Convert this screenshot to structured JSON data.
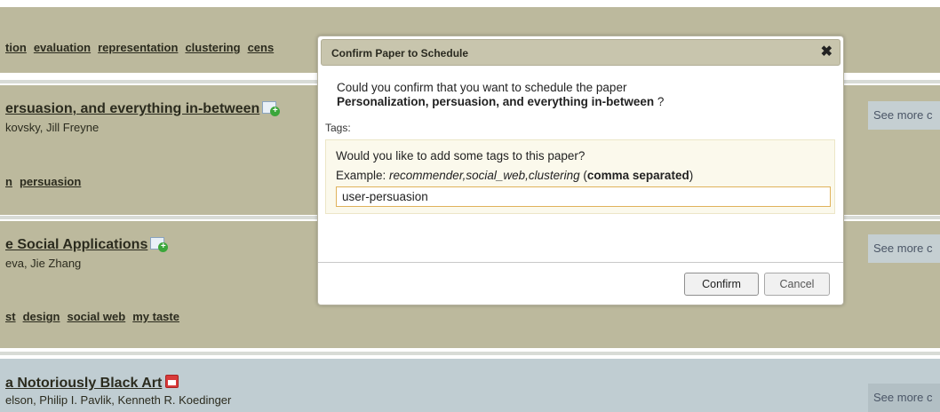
{
  "background": {
    "top_tags": [
      "tion",
      "evaluation",
      "representation",
      "clustering",
      "cens"
    ],
    "papers": [
      {
        "title": "ersuasion, and everything in-between",
        "authors": "kovsky, Jill Freyne",
        "tags": [
          "n",
          "persuasion"
        ],
        "see_more": "See more c",
        "icon": "add-to-schedule-icon"
      },
      {
        "title": "e Social Applications",
        "authors": "eva, Jie Zhang",
        "tags": [
          "st",
          "design",
          "social web",
          "my taste"
        ],
        "see_more": "See more c",
        "icon": "add-to-schedule-icon"
      },
      {
        "title": "a Notoriously Black Art",
        "authors": "elson, Philip I. Pavlik, Kenneth R. Koedinger",
        "see_more": "See more c",
        "icon": "remove-from-schedule-icon"
      }
    ]
  },
  "dialog": {
    "title": "Confirm Paper to Schedule",
    "close_glyph": "✖",
    "question": "Could you confirm that you want to schedule the paper",
    "paper_title": "Personalization, persuasion, and everything in-between",
    "question_end": " ?",
    "tags_label": "Tags:",
    "tags_question": "Would you like to add some tags to this paper?",
    "example_prefix": "Example: ",
    "example_value": "recommender,social_web,clustering",
    "example_note": "comma separated",
    "tags_input_value": "user-persuasion",
    "confirm_label": "Confirm",
    "cancel_label": "Cancel"
  }
}
